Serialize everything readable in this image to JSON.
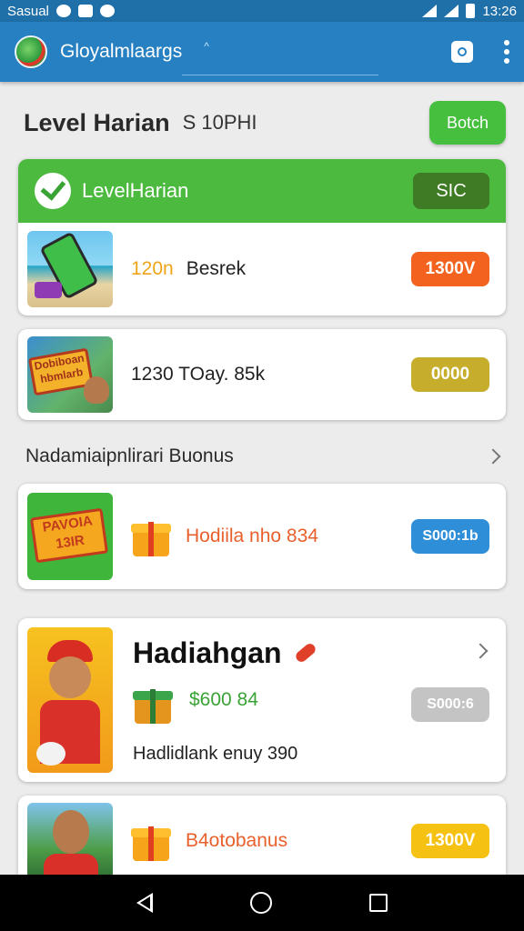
{
  "status_bar": {
    "left_text": "Sasual",
    "time": "13:26"
  },
  "app_bar": {
    "title": "Gloyalmlaargs",
    "subtitle": "^"
  },
  "header": {
    "title": "Level Harian",
    "subtitle": "S   10PHI",
    "button_label": "Botch"
  },
  "level_card": {
    "title": "LevelHarian",
    "badge": "SIC",
    "rows": [
      {
        "text_accent": "120n",
        "text": "Besrek",
        "pill": "1300V",
        "pill_color": "#f4621f"
      },
      {
        "text": "1230  TOay. 85k",
        "pill": "0000",
        "pill_color": "#c7ad2c"
      }
    ]
  },
  "section": {
    "label": "Nadamiaipnlirari Buonus"
  },
  "bonus_card": {
    "thumb_text": "PAVOIA 13IR",
    "text": "Hodiila nho 834",
    "pill": "S000:1b",
    "pill_color": "#2f8ed8"
  },
  "big_card": {
    "title": "Hadiahgan",
    "amount": "$600 84",
    "footer": "Hadlidlank enuy 390",
    "pill": "S000:6",
    "pill_color": "#c4c4c4"
  },
  "last_card": {
    "text": "B4otobanus",
    "pill": "1300V",
    "pill_color": "#f5c113"
  },
  "thumb_labels": {
    "second": "Dobiboan hbmlarb"
  },
  "colors": {
    "primary": "#2680c2",
    "green": "#4cba3f",
    "orange_text": "#e8612c"
  }
}
